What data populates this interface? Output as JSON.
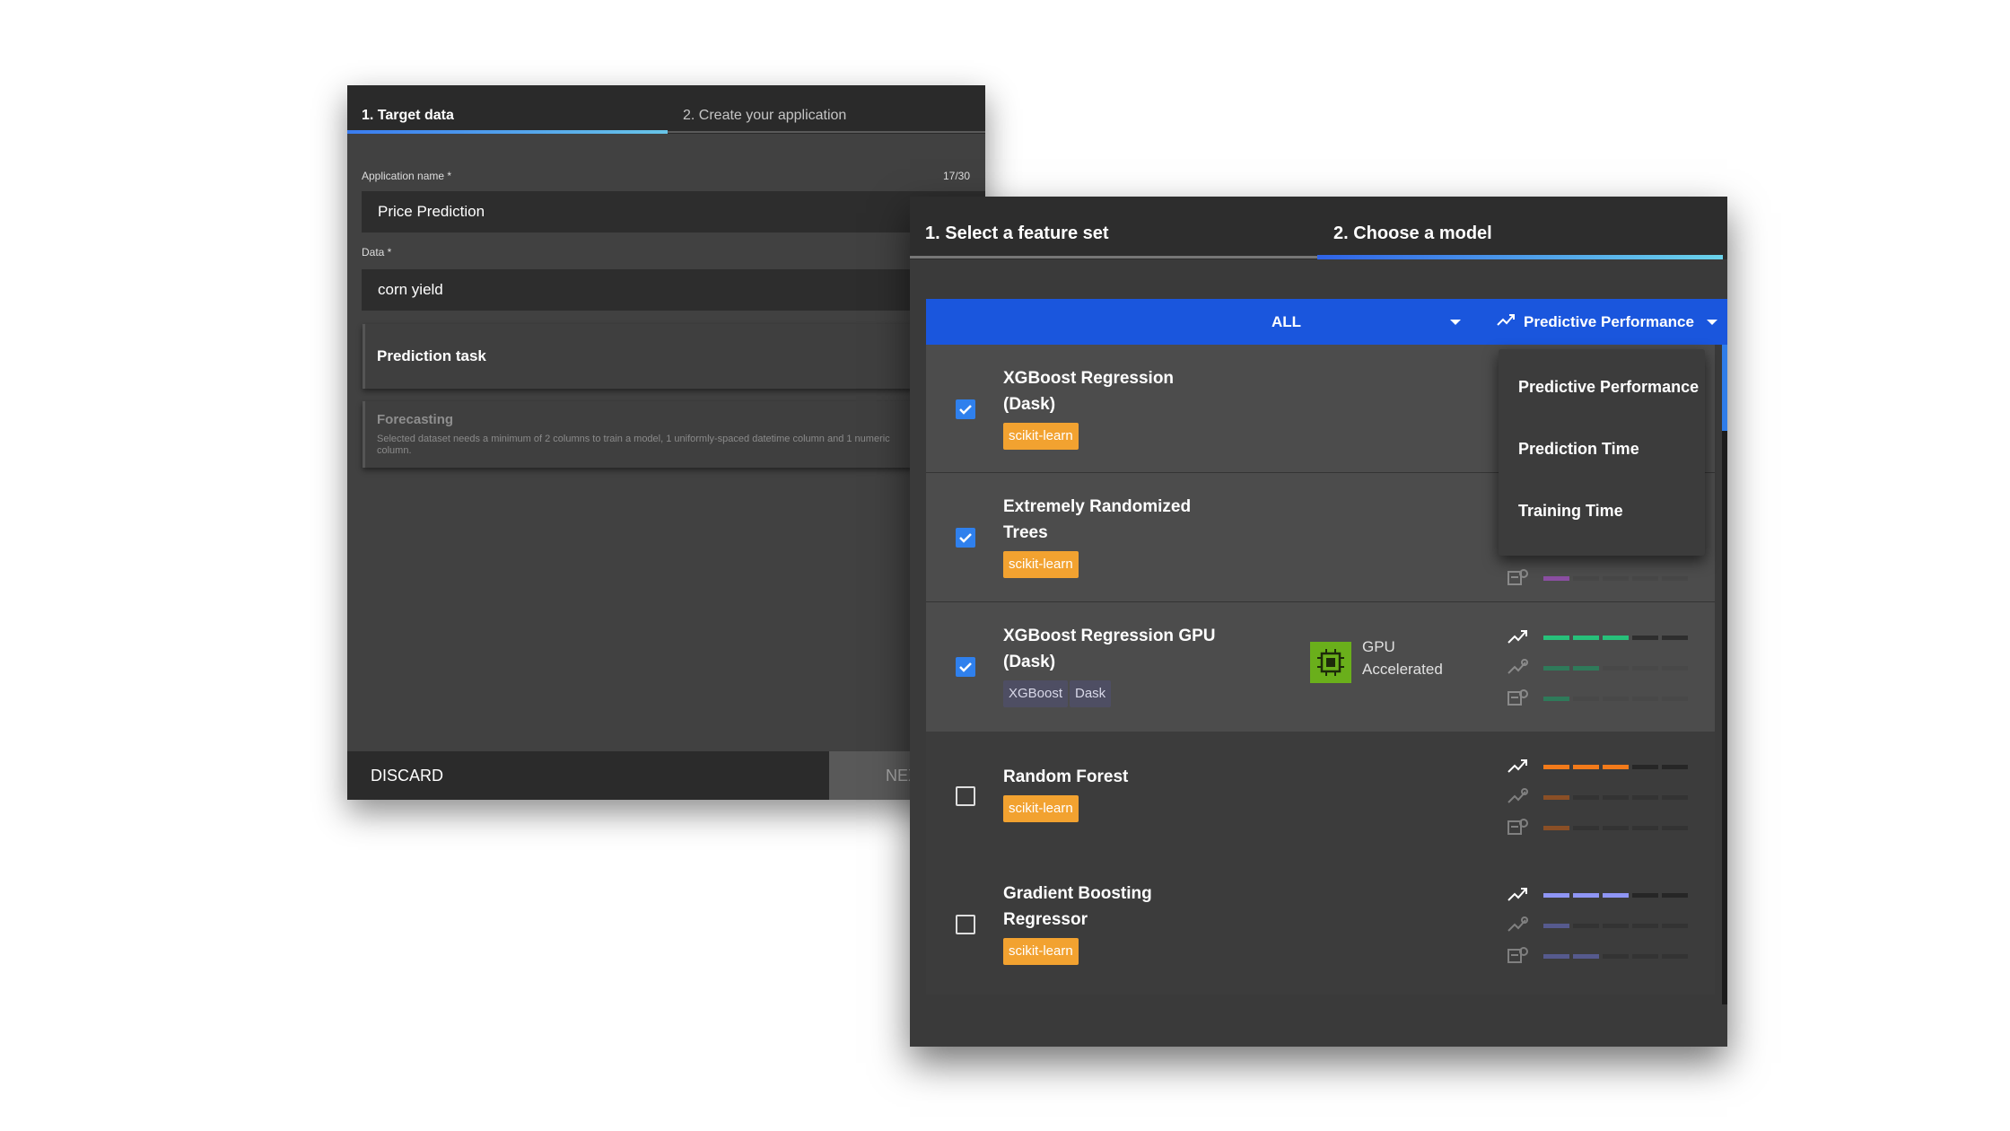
{
  "back_panel": {
    "tabs": [
      "1. Target data",
      "2. Create your application"
    ],
    "app_name_label": "Application name *",
    "app_name_counter": "17/30",
    "app_name_value": "Price Prediction",
    "data_label": "Data *",
    "data_value": "corn yield",
    "task_card_title": "Prediction task",
    "forecast_card_title": "Forecasting",
    "forecast_card_text": "Selected dataset needs a minimum of 2 columns to train a model, 1 uniformly-spaced datetime column and 1 numeric column.",
    "discard_label": "DISCARD",
    "next_label": "NEXT"
  },
  "front_panel": {
    "tabs": [
      "1. Select a feature set",
      "2. Choose a model"
    ],
    "filter_value": "ALL",
    "sort_value": "Predictive Performance",
    "sort_menu": [
      "Predictive Performance",
      "Prediction Time",
      "Training Time"
    ],
    "models": [
      {
        "name_line1": "XGBoost Regression",
        "name_line2": "(Dask)",
        "checked": true,
        "tags": [
          "scikit-learn"
        ]
      },
      {
        "name_line1": "Extremely Randomized",
        "name_line2": "Trees",
        "checked": true,
        "tags": [
          "scikit-learn"
        ]
      },
      {
        "name_line1": "XGBoost Regression GPU",
        "name_line2": "(Dask)",
        "checked": true,
        "tags": [
          "XGBoost",
          "Dask"
        ],
        "gpu_line1": "GPU",
        "gpu_line2": "Accelerated"
      },
      {
        "name_line1": "Random Forest",
        "name_line2": "",
        "checked": false,
        "tags": [
          "scikit-learn"
        ]
      },
      {
        "name_line1": "Gradient Boosting",
        "name_line2": "Regressor",
        "checked": false,
        "tags": [
          "scikit-learn"
        ]
      }
    ],
    "metric_icons": [
      "performance-icon",
      "prediction-time-icon",
      "training-time-icon"
    ],
    "metric_levels": {
      "extremely_randomized_trees": {
        "color": "#9b59b6",
        "training_time": 1
      },
      "xgboost_gpu": {
        "color": "#27c07a",
        "performance": 3,
        "prediction_time": 2,
        "training_time": 1
      },
      "random_forest": {
        "color": "#f27a1a",
        "performance": 3,
        "prediction_time": 1,
        "training_time": 1
      },
      "gradient_boosting": {
        "color": "#8f96f5",
        "performance": 3,
        "prediction_time": 1,
        "training_time": 2
      }
    },
    "colors": {
      "accent_blue": "#1a56dd",
      "tag_orange": "#f2a230",
      "gpu_green": "#6aaf1b"
    }
  }
}
